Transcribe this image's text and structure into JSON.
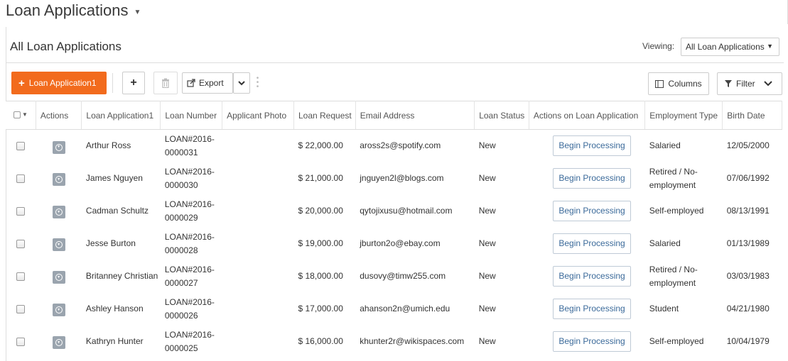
{
  "header": {
    "title": "Loan Applications"
  },
  "list": {
    "title": "All Loan Applications",
    "viewing_label": "Viewing:",
    "viewing_value": "All Loan Applications"
  },
  "toolbar": {
    "new_label": "Loan Application1",
    "export_label": "Export",
    "columns_label": "Columns",
    "filter_label": "Filter"
  },
  "table": {
    "headers": [
      "Actions",
      "Loan Application1",
      "Loan Number",
      "Applicant Photo",
      "Loan Request",
      "Email Address",
      "Loan Status",
      "Actions on Loan Application",
      "Employment Type",
      "Birth Date"
    ],
    "action_button_label": "Begin Processing",
    "rows": [
      {
        "name": "Arthur Ross",
        "number": "LOAN#2016-0000031",
        "request": "$ 22,000.00",
        "email": "aross2s@spotify.com",
        "status": "New",
        "employment": "Salaried",
        "birth": "12/05/2000"
      },
      {
        "name": "James Nguyen",
        "number": "LOAN#2016-0000030",
        "request": "$ 21,000.00",
        "email": "jnguyen2l@blogs.com",
        "status": "New",
        "employment": "Retired / No-employment",
        "birth": "07/06/1992"
      },
      {
        "name": "Cadman Schultz",
        "number": "LOAN#2016-0000029",
        "request": "$ 20,000.00",
        "email": "qytojixusu@hotmail.com",
        "status": "New",
        "employment": "Self-employed",
        "birth": "08/13/1991"
      },
      {
        "name": "Jesse Burton",
        "number": "LOAN#2016-0000028",
        "request": "$ 19,000.00",
        "email": "jburton2o@ebay.com",
        "status": "New",
        "employment": "Salaried",
        "birth": "01/13/1989"
      },
      {
        "name": "Britanney Christian",
        "number": "LOAN#2016-0000027",
        "request": "$ 18,000.00",
        "email": "dusovy@timw255.com",
        "status": "New",
        "employment": "Retired / No-employment",
        "birth": "03/03/1983"
      },
      {
        "name": "Ashley Hanson",
        "number": "LOAN#2016-0000026",
        "request": "$ 17,000.00",
        "email": "ahanson2n@umich.edu",
        "status": "New",
        "employment": "Student",
        "birth": "04/21/1980"
      },
      {
        "name": "Kathryn Hunter",
        "number": "LOAN#2016-0000025",
        "request": "$ 16,000.00",
        "email": "khunter2r@wikispaces.com",
        "status": "New",
        "employment": "Self-employed",
        "birth": "10/04/1979"
      }
    ]
  },
  "icons": {
    "add": "plus-icon",
    "delete": "trash-icon",
    "export": "external-link-icon",
    "columns": "columns-icon",
    "filter": "funnel-icon",
    "row_action": "circle-chevron-down-icon"
  },
  "colors": {
    "primary": "#f26b1d",
    "link": "#3b6a9a",
    "row_action_icon": "#9aa4ae"
  }
}
